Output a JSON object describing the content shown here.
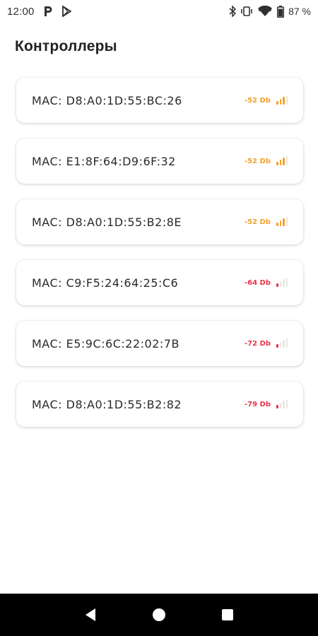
{
  "status_bar": {
    "time": "12:00",
    "battery_percent": "87 %",
    "icons_left": [
      "p-icon",
      "play-store-icon"
    ],
    "icons_right": [
      "bluetooth-icon",
      "vibrate-icon",
      "wifi-icon",
      "battery-icon"
    ]
  },
  "page": {
    "title": "Контроллеры"
  },
  "controllers": [
    {
      "mac": "MAC: D8:A0:1D:55:BC:26",
      "rssi": "-52 Db",
      "level": 3,
      "color": "#f5a02a"
    },
    {
      "mac": "MAC: E1:8F:64:D9:6F:32",
      "rssi": "-52 Db",
      "level": 3,
      "color": "#f5a02a"
    },
    {
      "mac": "MAC: D8:A0:1D:55:B2:8E",
      "rssi": "-52 Db",
      "level": 3,
      "color": "#f5a02a"
    },
    {
      "mac": "MAC: C9:F5:24:64:25:C6",
      "rssi": "-64 Db",
      "level": 1,
      "color": "#e8344a"
    },
    {
      "mac": "MAC: E5:9C:6C:22:02:7B",
      "rssi": "-72 Db",
      "level": 1,
      "color": "#e8344a"
    },
    {
      "mac": "MAC: D8:A0:1D:55:B2:82",
      "rssi": "-79 Db",
      "level": 1,
      "color": "#e8344a"
    }
  ],
  "nav_bar": {
    "buttons": [
      "back-icon",
      "home-icon",
      "recents-icon"
    ]
  }
}
